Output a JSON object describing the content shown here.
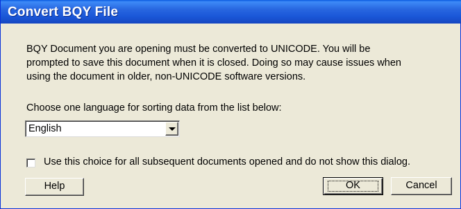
{
  "window": {
    "title": "Convert BQY File"
  },
  "message": {
    "line1": "BQY Document you are opening must be converted to UNICODE. You will be",
    "line2": "prompted to save this document when it is closed. Doing so may cause issues when",
    "line3": "using the document in older, non-UNICODE software versions."
  },
  "language": {
    "prompt": "Choose one language for sorting data from the list below:",
    "selected": "English"
  },
  "checkbox": {
    "label": "Use this choice for all subsequent documents opened and do not show this dialog.",
    "checked": false
  },
  "buttons": {
    "help": "Help",
    "ok": "OK",
    "cancel": "Cancel"
  },
  "icons": {
    "dropdown": "chevron-down-icon"
  }
}
